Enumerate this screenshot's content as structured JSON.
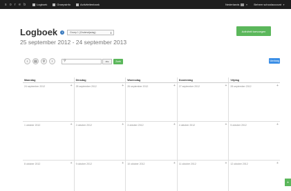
{
  "topbar": {
    "logo": "s o r e b",
    "nav": [
      {
        "label": "Logboek",
        "icon": "book-icon"
      },
      {
        "label": "Groepsinfo",
        "icon": "pencil-icon"
      },
      {
        "label": "Activiteitenbank",
        "icon": "bank-icon"
      }
    ],
    "language": "Nederlands",
    "user": "Beheer schoolaccount"
  },
  "header": {
    "title": "Logboek",
    "group_select": "Groep 1 (Onderwijsdag)",
    "add_button": "Activiteit toevoegen",
    "date_range": "25 september 2012 - 24 september 2013"
  },
  "toolbar": {
    "nav_buttons": [
      {
        "icon": "chevron-left-icon",
        "glyph": "‹"
      },
      {
        "icon": "print-icon",
        "glyph": "▤"
      },
      {
        "icon": "search-icon",
        "glyph": "⚲"
      },
      {
        "icon": "chevron-right-icon",
        "glyph": "›"
      }
    ],
    "search_placeholder": "",
    "filter_select": "Alle",
    "go_button": "Zoek",
    "today_button": "Vandaag"
  },
  "calendar": {
    "days": [
      "Maandag",
      "Dinsdag",
      "Woensdag",
      "Donderdag",
      "Vrijdag"
    ],
    "rows": [
      [
        "24 september 2012",
        "25 september 2012",
        "26 september 2012",
        "27 september 2012",
        "28 september 2012"
      ],
      [
        "1 oktober 2012",
        "2 oktober 2012",
        "3 oktober 2012",
        "4 oktober 2012",
        "5 oktober 2012"
      ],
      [
        "8 oktober 2012",
        "9 oktober 2012",
        "10 oktober 2012",
        "11 oktober 2012",
        "12 oktober 2012"
      ]
    ]
  },
  "side_button": "+"
}
